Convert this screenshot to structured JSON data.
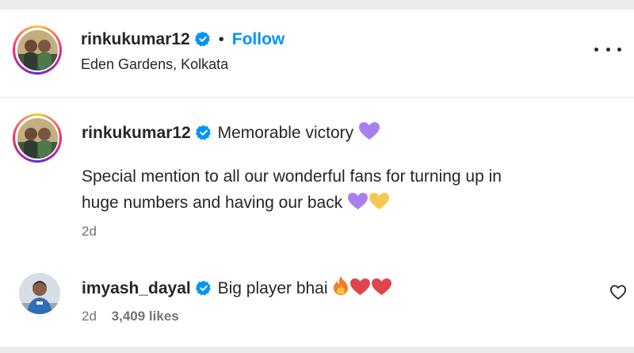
{
  "post_header": {
    "username": "rinkukumar12",
    "separator": "•",
    "follow_label": "Follow",
    "location": "Eden Gardens, Kolkata"
  },
  "caption": {
    "username": "rinkukumar12",
    "line1": "Memorable victory",
    "line2": "Special mention to all our wonderful fans for turning up in",
    "line3": "huge numbers and having our back",
    "time": "2d"
  },
  "comment": {
    "username": "imyash_dayal",
    "text": "Big player bhai",
    "time": "2d",
    "likes": "3,409 likes"
  },
  "icons": {
    "verified": "verified-badge-icon",
    "more": "more-options-icon",
    "like": "heart-outline-icon",
    "emoji_purple_heart": "purple-heart-emoji",
    "emoji_yellow_heart": "yellow-heart-emoji",
    "emoji_fire": "fire-emoji",
    "emoji_red_heart": "red-heart-emoji"
  },
  "colors": {
    "follow": "#0095f6",
    "verified": "#0095f6",
    "muted_text": "#737373",
    "purple_heart": "#a97ff0",
    "yellow_heart": "#f5c94e",
    "red_heart": "#e0454b"
  }
}
